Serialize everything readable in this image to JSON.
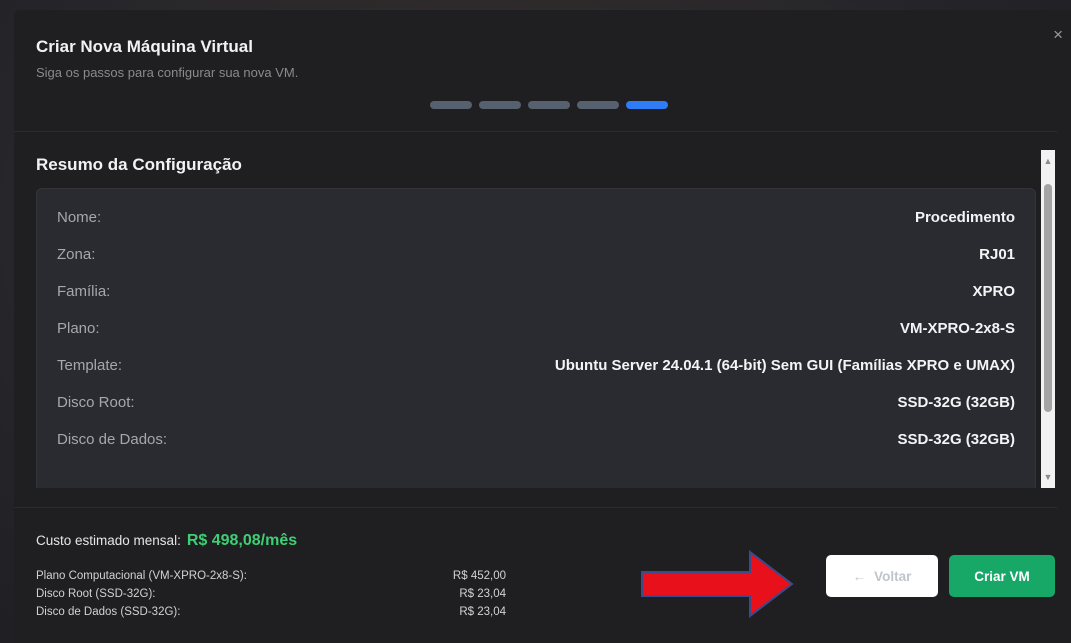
{
  "modal": {
    "title": "Criar Nova Máquina Virtual",
    "subtitle": "Siga os passos para configurar sua nova VM.",
    "close_label": "×",
    "steps": {
      "total": 5,
      "current": 5
    }
  },
  "summary": {
    "title": "Resumo da Configuração",
    "rows": [
      {
        "label": "Nome:",
        "value": "Procedimento"
      },
      {
        "label": "Zona:",
        "value": "RJ01"
      },
      {
        "label": "Família:",
        "value": "XPRO"
      },
      {
        "label": "Plano:",
        "value": "VM-XPRO-2x8-S"
      },
      {
        "label": "Template:",
        "value": "Ubuntu Server 24.04.1 (64-bit) Sem GUI (Famílias XPRO e UMAX)"
      },
      {
        "label": "Disco Root:",
        "value": "SSD-32G (32GB)"
      },
      {
        "label": "Disco de Dados:",
        "value": "SSD-32G (32GB)"
      }
    ]
  },
  "cost": {
    "label": "Custo estimado mensal:",
    "value": "R$ 498,08/mês",
    "breakdown": [
      {
        "name": "Plano Computacional (VM-XPRO-2x8-S):",
        "value": "R$ 452,00"
      },
      {
        "name": "Disco Root (SSD-32G):",
        "value": "R$ 23,04"
      },
      {
        "name": "Disco de Dados (SSD-32G):",
        "value": "R$ 23,04"
      }
    ]
  },
  "buttons": {
    "back_arrow": "←",
    "back_label": "Voltar",
    "create_label": "Criar VM"
  },
  "colors": {
    "accent_step": "#2e7cf6",
    "cost_green": "#3ecf74",
    "create_button": "#17a868",
    "annotation_arrow": "#e8101a"
  }
}
